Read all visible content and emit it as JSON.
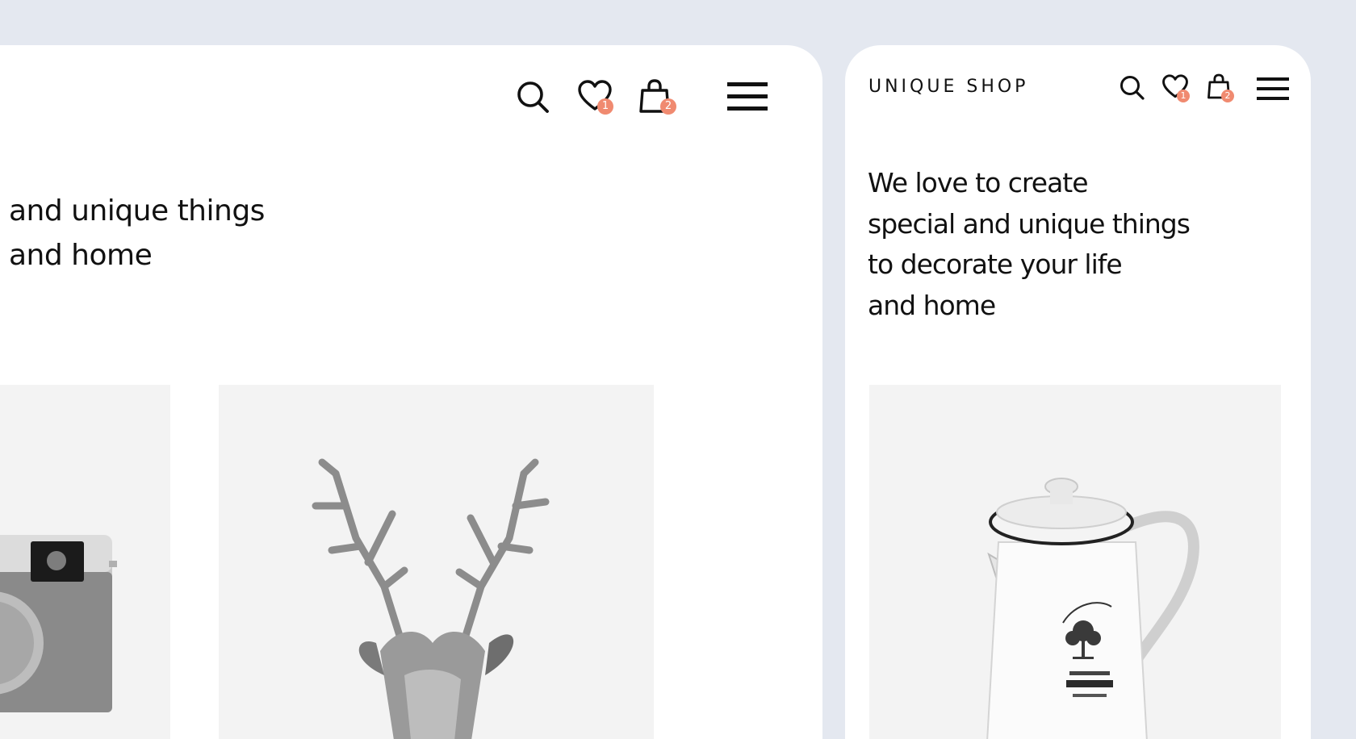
{
  "desktop": {
    "hero_lines": [
      "and unique things",
      "and home"
    ],
    "wishlist_count": "1",
    "cart_count": "2",
    "icons": [
      "search-icon",
      "heart-icon",
      "bag-icon",
      "menu-icon"
    ]
  },
  "mobile": {
    "brand": "UNIQUE SHOP",
    "hero_lines": [
      "We love to create",
      "special and unique things",
      "to decorate your life",
      "and home"
    ],
    "wishlist_count": "1",
    "cart_count": "2",
    "icons": [
      "search-icon",
      "heart-icon",
      "bag-icon",
      "menu-icon"
    ]
  },
  "products": [
    "camera-product-image",
    "deer-head-product-image",
    "coffee-pot-product-image"
  ],
  "colors": {
    "background": "#e4e8f0",
    "card": "#ffffff",
    "badge": "#f08a70",
    "tile": "#f3f3f3"
  }
}
